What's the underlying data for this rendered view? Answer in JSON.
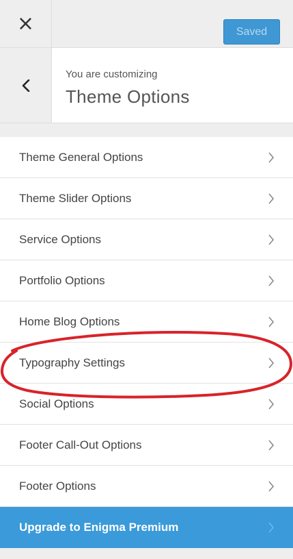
{
  "topbar": {
    "close_icon": "close-icon",
    "close_glyph": "×",
    "saved_label": "Saved",
    "saved_color": "#3f97d3"
  },
  "header": {
    "back_icon": "chevron-left-icon",
    "customizing_label": "You are customizing",
    "section_title": "Theme Options"
  },
  "menu": {
    "chevron_icon": "chevron-right-icon",
    "items": [
      {
        "label": "Theme General Options"
      },
      {
        "label": "Theme Slider Options"
      },
      {
        "label": "Service Options"
      },
      {
        "label": "Portfolio Options"
      },
      {
        "label": "Home Blog Options"
      },
      {
        "label": "Typography Settings",
        "highlighted": true
      },
      {
        "label": "Social Options"
      },
      {
        "label": "Footer Call-Out Options"
      },
      {
        "label": "Footer Options"
      },
      {
        "label": "Upgrade to Enigma Premium",
        "premium": true
      }
    ]
  },
  "colors": {
    "accent": "#3b9ad9",
    "highlight_ring": "#d8232a",
    "background": "#eeeeee"
  }
}
